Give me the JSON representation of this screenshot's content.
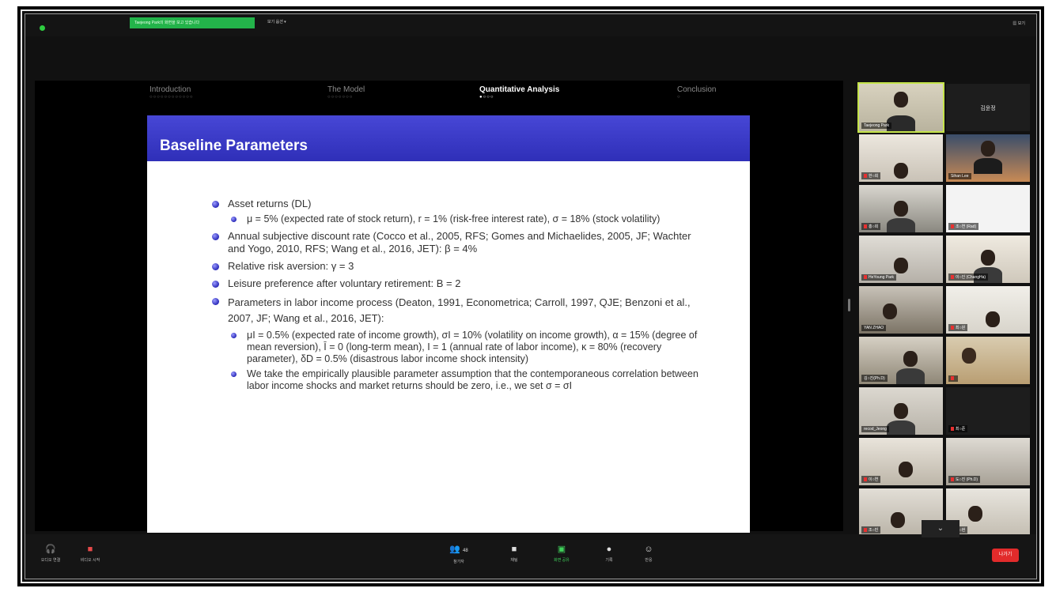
{
  "window": {
    "speaker_tag": "Taejeong Park의 화면을 보고 있습니다",
    "view_options": "보기 옵션 ▾",
    "top_right": "▦ 보기"
  },
  "slide_nav": {
    "sections": [
      {
        "label": "Introduction",
        "dots": "○○○○○○○○○○○○",
        "active": false
      },
      {
        "label": "The Model",
        "dots": "○○○○○○○",
        "active": false
      },
      {
        "label": "Quantitative Analysis",
        "dots": "●○○○",
        "active": true
      },
      {
        "label": "Conclusion",
        "dots": "○",
        "active": false
      }
    ]
  },
  "slide": {
    "title": "Baseline Parameters",
    "b1": "Asset returns (DL)",
    "b1_sub": "μ = 5% (expected rate of stock return), r = 1% (risk-free interest rate), σ = 18% (stock volatility)",
    "b2": "Annual subjective discount rate (Cocco et al., 2005, RFS; Gomes and Michaelides, 2005, JF; Wachter and Yogo, 2010, RFS; Wang et al., 2016, JET): β = 4%",
    "b3": "Relative risk aversion: γ = 3",
    "b4": "Leisure preference after voluntary retirement: B = 2",
    "b5": "Parameters in labor income process (Deaton, 1991, Econometrica; Carroll, 1997, QJE; Benzoni et al., 2007, JF; Wang et al., 2016, JET):",
    "b5_sub1": "μI = 0.5% (expected rate of income growth), σI = 10% (volatility on income growth), α = 15% (degree of mean reversion), Ī = 0 (long-term mean), I = 1 (annual rate of labor income), κ = 80% (recovery parameter), δD = 0.5% (disastrous labor income shock intensity)",
    "b5_sub2": "We take the empirically plausible parameter assumption that the contemporaneous correlation between labor income shocks and market returns should be zero, i.e., we set σ = σI"
  },
  "gallery": {
    "active_name": "Taejeong Park",
    "blank_tile_name": "김윤정",
    "names": [
      "한○희",
      "Sihan Lee",
      "홍○희",
      "조○연 (Rad)",
      "HeYoung Park",
      "이○인 (ChangHa)",
      "",
      "최○원",
      "YAN ZHAO",
      "",
      "김○진(Ph.D)",
      "",
      "recod_Jeong",
      "최○준",
      "이○연",
      "도○진 (Ph.D)",
      "조○빈",
      "도○현"
    ],
    "more_label": "⌄"
  },
  "toolbar": {
    "audio_label": "오디오 연결",
    "video_label": "비디오 시작",
    "participants_label": "참가자",
    "participants_count": "48",
    "chat_label": "채팅",
    "share_label": "화면 공유",
    "record_label": "기록",
    "reactions_label": "반응",
    "end_label": "나가기"
  }
}
